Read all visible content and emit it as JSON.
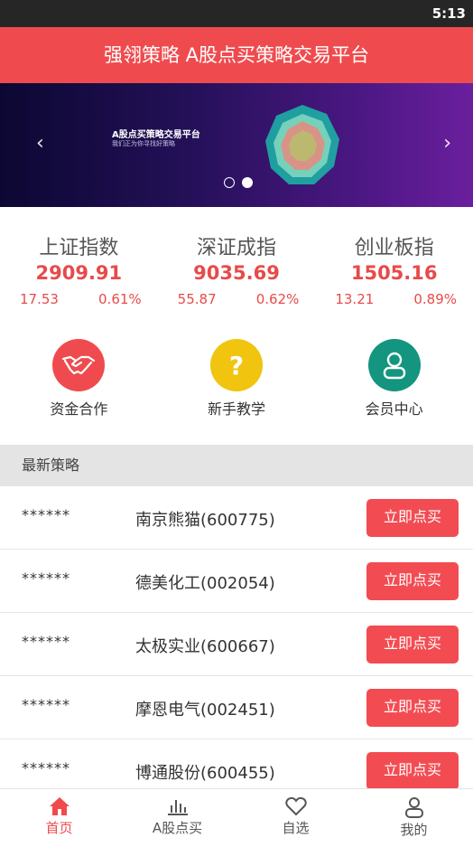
{
  "status_bar": {
    "time": "5:13"
  },
  "app_bar": {
    "title": "强翎策略 A股点买策略交易平台"
  },
  "banner": {
    "title": "A股点买策略交易平台",
    "subtitle": "我们正为你寻找好策略",
    "prev_icon": "chevron-left",
    "next_icon": "chevron-right",
    "slide_count": 2,
    "active_slide": 2
  },
  "indices": [
    {
      "name": "上证指数",
      "value": "2909.91",
      "change": "17.53",
      "percent": "0.61%"
    },
    {
      "name": "深证成指",
      "value": "9035.69",
      "change": "55.87",
      "percent": "0.62%"
    },
    {
      "name": "创业板指",
      "value": "1505.16",
      "change": "13.21",
      "percent": "0.89%"
    }
  ],
  "quick_actions": [
    {
      "label": "资金合作",
      "icon": "handshake-icon",
      "color": "#ef4b4e"
    },
    {
      "label": "新手教学",
      "icon": "question-icon",
      "color": "#f0c40f"
    },
    {
      "label": "会员中心",
      "icon": "user-icon",
      "color": "#13957f"
    }
  ],
  "strategies": {
    "header": "最新策略",
    "button_label": "立即点买",
    "items": [
      {
        "user": "******",
        "stock": "南京熊猫(600775)"
      },
      {
        "user": "******",
        "stock": "德美化工(002054)"
      },
      {
        "user": "******",
        "stock": "太极实业(600667)"
      },
      {
        "user": "******",
        "stock": "摩恩电气(002451)"
      },
      {
        "user": "******",
        "stock": "博通股份(600455)"
      }
    ]
  },
  "tabbar": {
    "items": [
      {
        "label": "首页",
        "icon": "home-icon",
        "active": true
      },
      {
        "label": "A股点买",
        "icon": "bar-chart-icon",
        "active": false
      },
      {
        "label": "自选",
        "icon": "heart-icon",
        "active": false
      },
      {
        "label": "我的",
        "icon": "profile-icon",
        "active": false
      }
    ]
  },
  "colors": {
    "brand_red": "#ef4b4e",
    "rise_red": "#e84a4a",
    "button_red": "#f24c52"
  }
}
